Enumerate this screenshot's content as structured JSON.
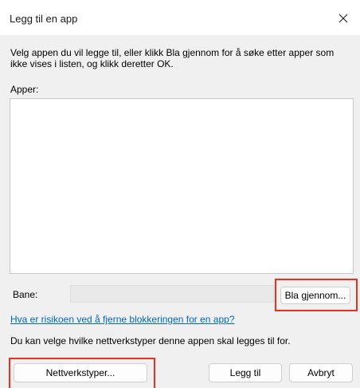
{
  "window": {
    "title": "Legg til en app",
    "close_icon": "close-icon"
  },
  "instructions": "Velg appen du vil legge til, eller klikk Bla gjennom for å søke etter apper som ikke vises i listen, og klikk deretter OK.",
  "apps": {
    "label": "Apper:",
    "items": []
  },
  "path": {
    "label": "Bane:",
    "value": "",
    "browse_label": "Bla gjennom..."
  },
  "risk_link": "Hva er risikoen ved å fjerne blokkeringen for en app?",
  "network_info": "Du kan velge hvilke nettverkstyper denne appen skal legges til for.",
  "buttons": {
    "network_types": "Nettverkstyper...",
    "add": "Legg til",
    "cancel": "Avbryt"
  },
  "colors": {
    "highlight": "#e8321f",
    "link": "#0067c0"
  }
}
